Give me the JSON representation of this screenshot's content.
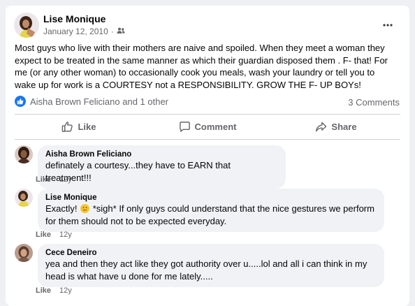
{
  "post": {
    "author": "Lise Monique",
    "date": "January 12, 2010",
    "separator": "·",
    "audience_icon": "friends-icon",
    "more_icon": "more-icon",
    "body": "Most guys who live with their mothers are naive and spoiled. When they meet a woman they expect to be treated in the same manner as which their guardian disposed them . F- that! For me (or any other woman) to occasionally cook you meals, wash your laundry or tell you to wake up for work is a COURTESY not a RESPONSIBILITY. GROW THE F- UP BOYs!",
    "reactions_text": "Aisha Brown Feliciano and 1 other",
    "comments_count": "3 Comments"
  },
  "actions": {
    "like": "Like",
    "comment": "Comment",
    "share": "Share"
  },
  "comments": [
    {
      "name": "Aisha Brown Feliciano",
      "text": "definately a courtesy...they have to EARN that treatment!!!",
      "like_label": "Like",
      "age": "12y"
    },
    {
      "name": "Lise Monique",
      "text_before": "Exactly! ",
      "emoji": "🙂",
      "text_after": " *sigh* If only guys could understand that the nice gestures we perform for them should not to be expected everyday.",
      "like_label": "Like",
      "age": "12y"
    },
    {
      "name": "Cece Deneiro",
      "text": "yea and then they act like they got authority over u.....lol and all i can think in my head is what have u done for me lately.....",
      "like_label": "Like",
      "age": "12y"
    }
  ],
  "colors": {
    "accent": "#1877f2",
    "bubble": "#f0f2f5",
    "muted": "#65676b"
  }
}
